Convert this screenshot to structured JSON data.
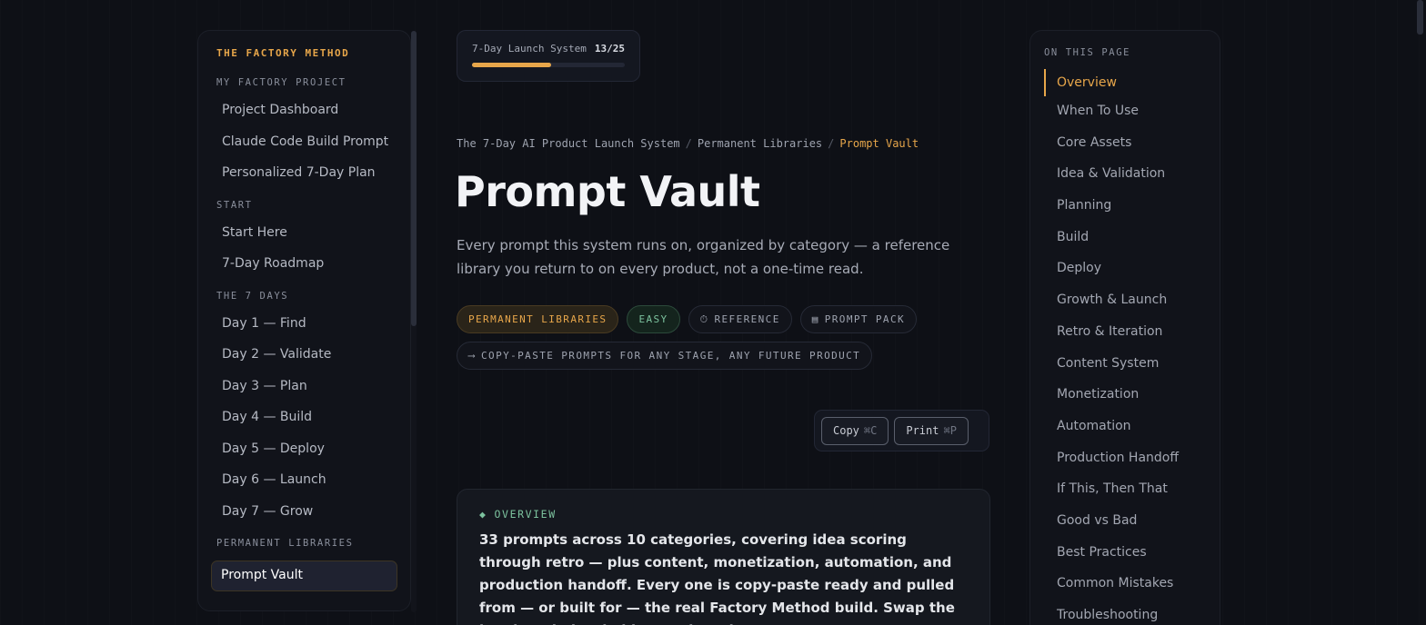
{
  "sidebar": {
    "brand": "THE FACTORY METHOD",
    "sections": [
      {
        "title": "MY FACTORY PROJECT",
        "items": [
          "Project Dashboard",
          "Claude Code Build Prompt",
          "Personalized 7-Day Plan"
        ]
      },
      {
        "title": "START",
        "items": [
          "Start Here",
          "7-Day Roadmap"
        ]
      },
      {
        "title": "THE 7 DAYS",
        "items": [
          "Day 1 — Find",
          "Day 2 — Validate",
          "Day 3 — Plan",
          "Day 4 — Build",
          "Day 5 — Deploy",
          "Day 6 — Launch",
          "Day 7 — Grow"
        ]
      },
      {
        "title": "PERMANENT LIBRARIES",
        "items": [
          "Prompt Vault"
        ]
      }
    ],
    "active_item": "Prompt Vault"
  },
  "progress": {
    "label": "7-Day Launch System",
    "count": "13/25",
    "fraction": 0.52,
    "color": "#e7a64a"
  },
  "breadcrumb": {
    "items": [
      "The 7-Day AI Product Launch System",
      "Permanent Libraries"
    ],
    "current": "Prompt Vault",
    "separator": "/"
  },
  "page": {
    "title": "Prompt Vault",
    "subtitle": "Every prompt this system runs on, organized by category — a reference library you return to on every product, not a one-time read."
  },
  "tags": {
    "category": "PERMANENT LIBRARIES",
    "difficulty": "EASY",
    "type": {
      "glyph": "⏱",
      "label": "REFERENCE"
    },
    "format": {
      "glyph": "▤",
      "label": "PROMPT PACK"
    },
    "outcome": {
      "glyph": "⟶",
      "label": "COPY-PASTE PROMPTS FOR ANY STAGE, ANY FUTURE PRODUCT"
    }
  },
  "actions": {
    "copy": {
      "label": "Copy",
      "shortcut": "⌘C"
    },
    "print": {
      "label": "Print",
      "shortcut": "⌘P"
    }
  },
  "overview": {
    "glyph": "◆",
    "label": "OVERVIEW",
    "text": "33 prompts across 10 categories, covering idea scoring through retro — plus content, monetization, automation, and production handoff. Every one is copy-paste ready and pulled from — or built for — the real Factory Method build. Swap the bracketed placeholders and run it."
  },
  "toc": {
    "title": "ON THIS PAGE",
    "items": [
      "Overview",
      "When To Use",
      "Core Assets",
      "Idea & Validation",
      "Planning",
      "Build",
      "Deploy",
      "Growth & Launch",
      "Retro & Iteration",
      "Content System",
      "Monetization",
      "Automation",
      "Production Handoff",
      "If This, Then That",
      "Good vs Bad",
      "Best Practices",
      "Common Mistakes",
      "Troubleshooting"
    ],
    "active": "Overview"
  },
  "colors": {
    "accent": "#e7a64a",
    "success": "#7cc29e",
    "background": "#0e1016"
  }
}
